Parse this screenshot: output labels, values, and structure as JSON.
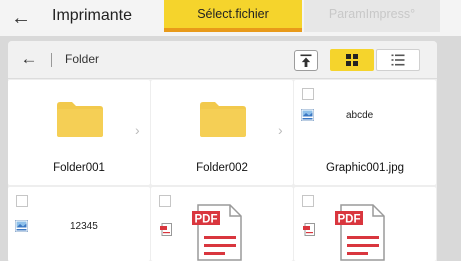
{
  "header": {
    "back_icon": "arrow-left-icon",
    "title": "Imprimante",
    "tabs": [
      {
        "label": "Sélect.fichier",
        "active": true
      },
      {
        "label": "ParamImpress°",
        "active": false
      }
    ]
  },
  "toolbar": {
    "back_icon": "arrow-left-icon",
    "breadcrumb": "Folder",
    "up_icon": "move-to-top-icon",
    "view_grid_icon": "grid-view-icon",
    "view_list_icon": "list-view-icon"
  },
  "items": [
    {
      "type": "folder",
      "label": "Folder001"
    },
    {
      "type": "folder",
      "label": "Folder002"
    },
    {
      "type": "image",
      "label": "Graphic001.jpg",
      "thumb_text": "abcde"
    },
    {
      "type": "image",
      "thumb_text": "12345"
    },
    {
      "type": "pdf",
      "badge": "PDF"
    },
    {
      "type": "pdf",
      "badge": "PDF"
    }
  ],
  "colors": {
    "accent": "#f5d42c",
    "accent_underline": "#e89a1a",
    "folder": "#f2c94c",
    "pdf": "#d9363e"
  }
}
